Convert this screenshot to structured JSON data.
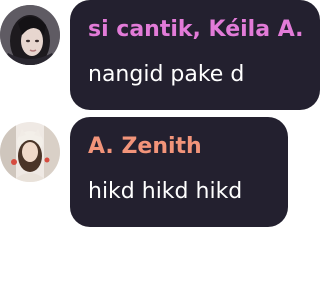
{
  "messages": [
    {
      "sender": "si cantik, Kéila A.",
      "sender_color": "#e27bd8",
      "text": "nangid pake d",
      "avatar": "user-avatar-photo"
    },
    {
      "sender": "A. Zenith",
      "sender_color": "#f2947a",
      "text": "hikd hikd hikd",
      "avatar": "user-avatar-photo"
    }
  ],
  "colors": {
    "bubble_background": "#23202f",
    "message_text": "#ffffff",
    "page_background": "#ffffff"
  }
}
